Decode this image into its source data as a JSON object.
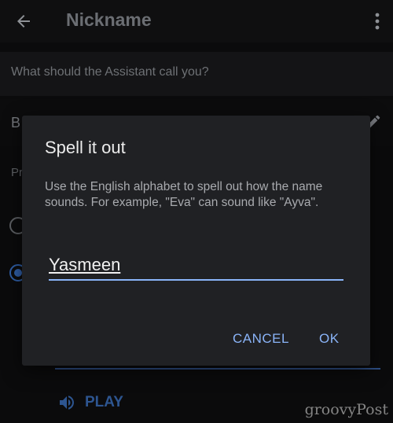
{
  "appbar": {
    "title": "Nickname"
  },
  "settings": {
    "question": "What should the Assistant call you?",
    "name_row_initial": "B",
    "pronunciation_label_partial": "Pr",
    "play_label": "PLAY"
  },
  "dialog": {
    "title": "Spell it out",
    "body": "Use the English alphabet to spell out how the name sounds. For example, \"Eva\" can sound like \"Ayva\".",
    "input_value": "Yasmeen",
    "cancel_label": "CANCEL",
    "ok_label": "OK"
  },
  "watermark": "groovyPost",
  "colors": {
    "accent": "#8ab4f8",
    "dialog_bg": "#202124",
    "screen_bg": "#0b0b0c"
  },
  "icons": [
    "back-arrow-icon",
    "more-vert-icon",
    "edit-pencil-icon",
    "volume-icon"
  ]
}
